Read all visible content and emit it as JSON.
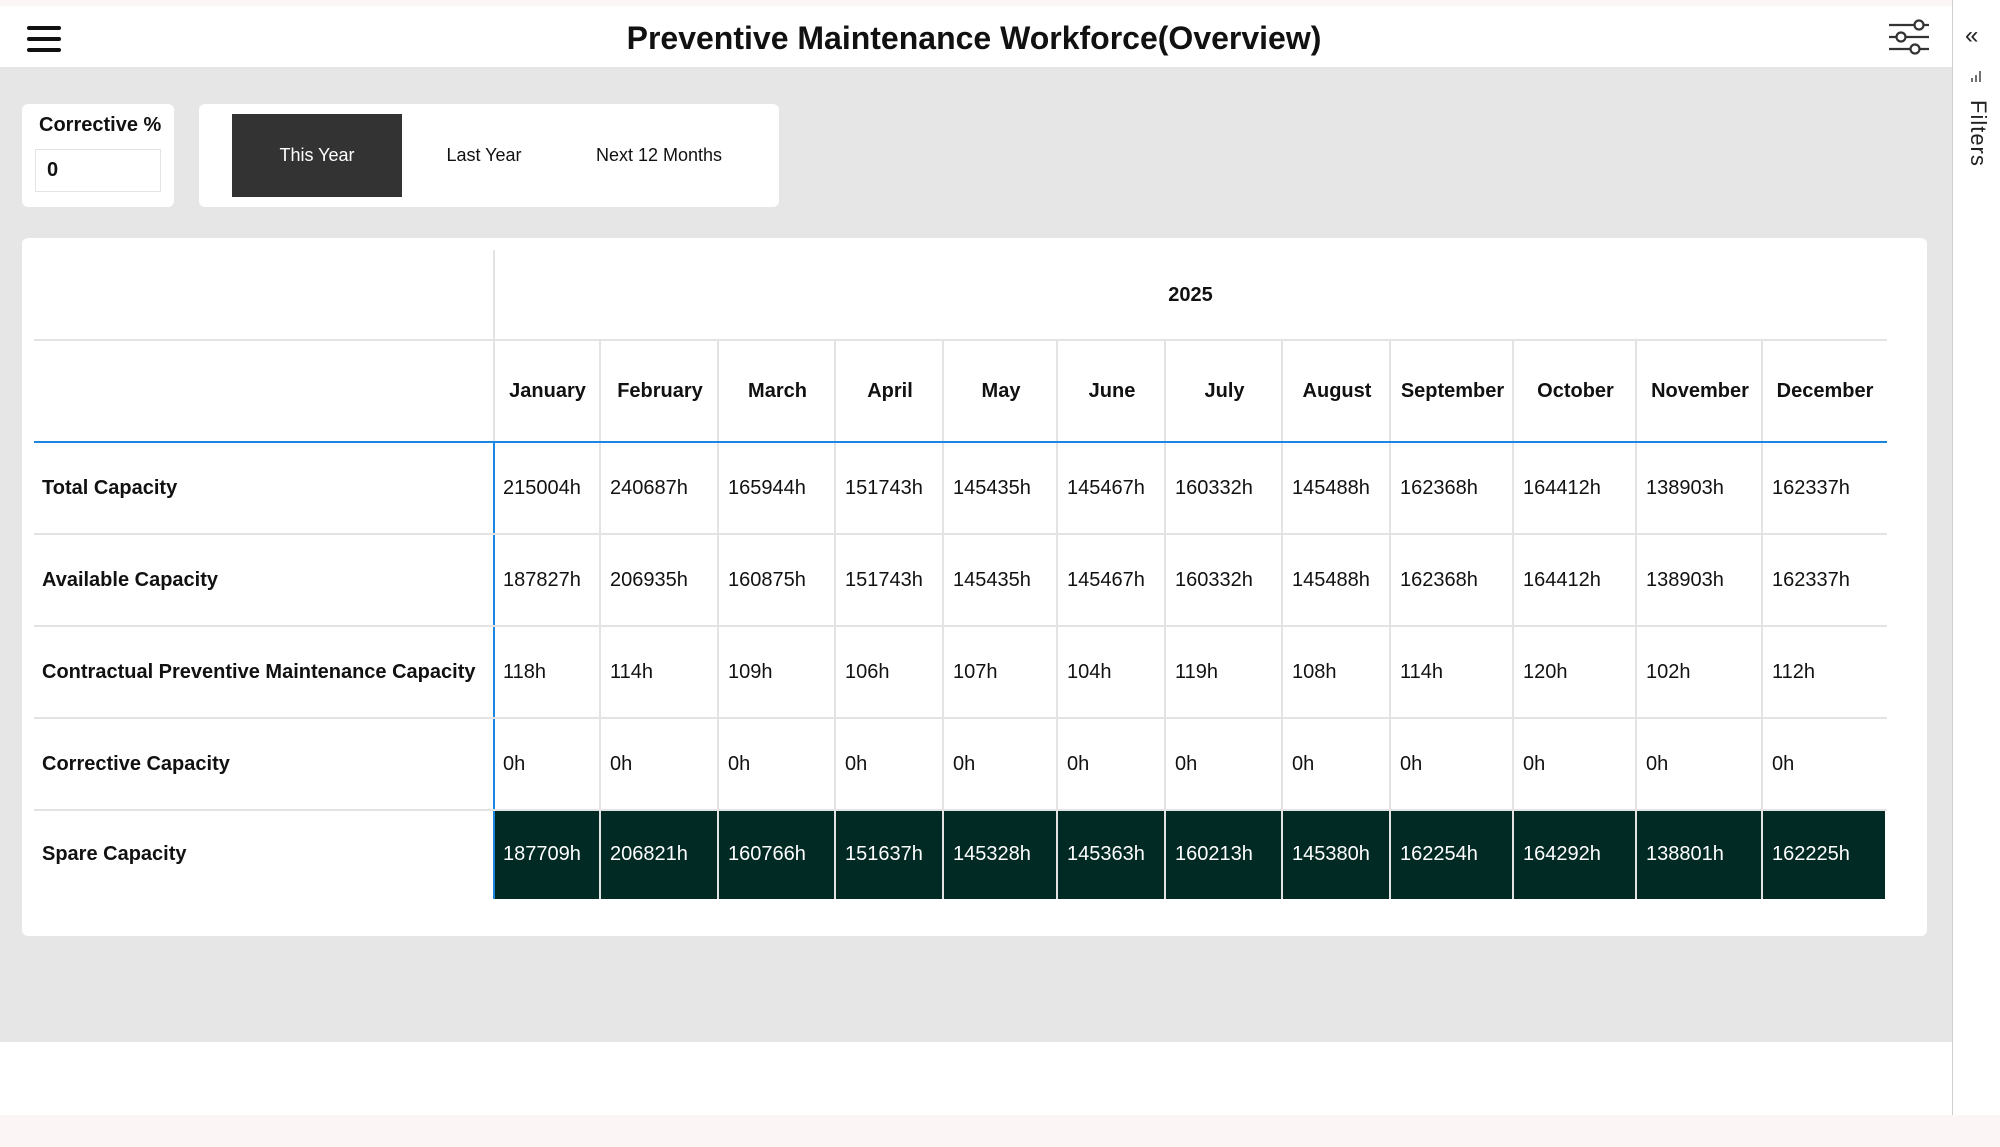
{
  "header": {
    "title": "Preventive Maintenance Workforce(Overview)"
  },
  "corrective": {
    "label": "Corrective %",
    "value": "0"
  },
  "period": {
    "options": [
      "This Year",
      "Last Year",
      "Next 12 Months"
    ],
    "selected": "This Year"
  },
  "table": {
    "year": "2025",
    "months": [
      "January",
      "February",
      "March",
      "April",
      "May",
      "June",
      "July",
      "August",
      "September",
      "October",
      "November",
      "December"
    ],
    "rows": [
      {
        "label": "Total Capacity",
        "values": [
          "215004h",
          "240687h",
          "165944h",
          "151743h",
          "145435h",
          "145467h",
          "160332h",
          "145488h",
          "162368h",
          "164412h",
          "138903h",
          "162337h"
        ]
      },
      {
        "label": "Available Capacity",
        "values": [
          "187827h",
          "206935h",
          "160875h",
          "151743h",
          "145435h",
          "145467h",
          "160332h",
          "145488h",
          "162368h",
          "164412h",
          "138903h",
          "162337h"
        ]
      },
      {
        "label": "Contractual Preventive Maintenance Capacity",
        "values": [
          "118h",
          "114h",
          "109h",
          "106h",
          "107h",
          "104h",
          "119h",
          "108h",
          "114h",
          "120h",
          "102h",
          "112h"
        ]
      },
      {
        "label": "Corrective Capacity",
        "values": [
          "0h",
          "0h",
          "0h",
          "0h",
          "0h",
          "0h",
          "0h",
          "0h",
          "0h",
          "0h",
          "0h",
          "0h"
        ]
      },
      {
        "label": "Spare Capacity",
        "values": [
          "187709h",
          "206821h",
          "160766h",
          "151637h",
          "145328h",
          "145363h",
          "160213h",
          "145380h",
          "162254h",
          "164292h",
          "138801h",
          "162225h"
        ]
      }
    ]
  },
  "sidebar": {
    "collapse_glyph": "«",
    "filters_label": "Filters"
  },
  "colors": {
    "spare_bg": "#022a24",
    "active_period_bg": "#333333",
    "accent_line": "#1a86e0"
  }
}
